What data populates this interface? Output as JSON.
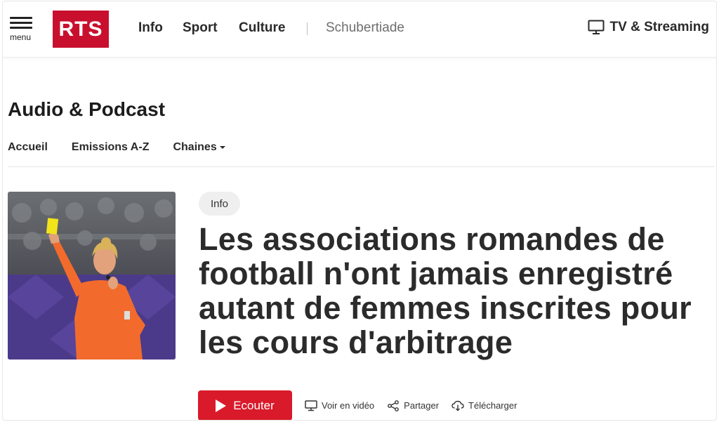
{
  "header": {
    "menu_label": "menu",
    "logo_text": "RTS",
    "nav": [
      "Info",
      "Sport",
      "Culture"
    ],
    "nav_secondary": "Schubertiade",
    "tv_link": "TV & Streaming"
  },
  "section": {
    "title": "Audio & Podcast",
    "subnav": [
      "Accueil",
      "Emissions A-Z",
      "Chaines"
    ]
  },
  "article": {
    "tag": "Info",
    "headline": "Les associations romandes de football n'ont jamais enregistré autant de femmes inscrites pour les cours d'arbitrage",
    "image_icon": "referee-photo",
    "actions": {
      "listen": "Ecouter",
      "video": "Voir en vidéo",
      "share": "Partager",
      "download": "Télécharger"
    }
  },
  "colors": {
    "brand_red": "#c8102e",
    "listen_button": "#d91a2a",
    "tag_bg": "#efefef"
  }
}
